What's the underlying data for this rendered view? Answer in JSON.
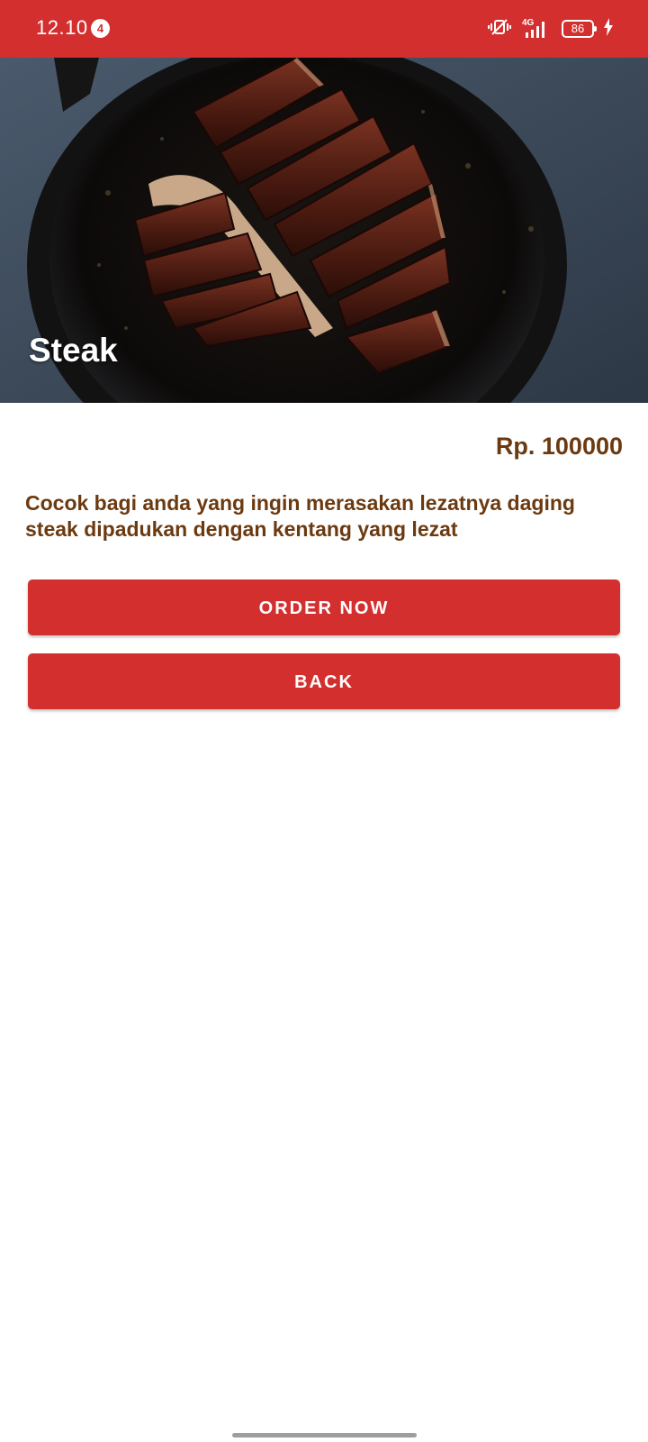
{
  "status_bar": {
    "time": "12.10",
    "notification_count": "4",
    "network_label": "4G",
    "battery_level": "86",
    "icons": [
      "vibrate-icon",
      "signal-4g-icon",
      "battery-icon",
      "charging-icon"
    ]
  },
  "product": {
    "name": "Steak",
    "price": "Rp. 100000",
    "description": "Cocok bagi anda yang ingin merasakan lezatnya daging steak dipadukan dengan kentang yang lezat",
    "image": "steak-photo"
  },
  "actions": {
    "order_label": "ORDER NOW",
    "back_label": "BACK"
  },
  "colors": {
    "primary": "#d32f2f",
    "text_accent": "#6b3a10",
    "background": "#ffffff"
  }
}
